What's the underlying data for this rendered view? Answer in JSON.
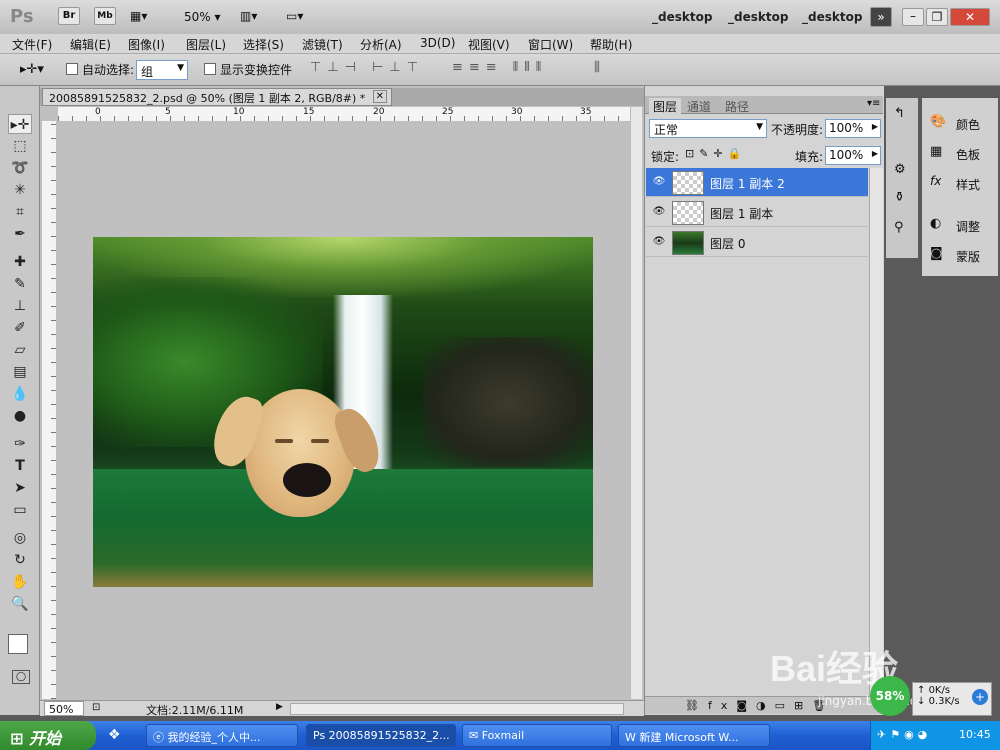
{
  "appbar": {
    "logo": "Ps",
    "br": "Br",
    "mb": "Mb",
    "zoom": "50%",
    "workspaces": [
      "_desktop",
      "_desktop",
      "_desktop"
    ]
  },
  "menu": [
    "文件(F)",
    "编辑(E)",
    "图像(I)",
    "图层(L)",
    "选择(S)",
    "滤镜(T)",
    "分析(A)",
    "3D(D)",
    "视图(V)",
    "窗口(W)",
    "帮助(H)"
  ],
  "options": {
    "auto_select_label": "自动选择:",
    "auto_select_value": "组",
    "show_transform_label": "显示变换控件"
  },
  "document": {
    "tab_title": "20085891525832_2.psd @ 50% (图层 1 副本 2, RGB/8#) *",
    "ruler_labels": [
      "0",
      "5",
      "10",
      "15",
      "20",
      "25",
      "30",
      "35"
    ],
    "zoom": "50%",
    "doc_size": "文档:2.11M/6.11M"
  },
  "panels": {
    "tabs": [
      "图层",
      "通道",
      "路径"
    ],
    "blend_mode": "正常",
    "opacity_label": "不透明度:",
    "opacity_value": "100%",
    "lock_label": "锁定:",
    "fill_label": "填充:",
    "fill_value": "100%",
    "layers": [
      {
        "name": "图层 1 副本 2",
        "selected": true
      },
      {
        "name": "图层 1 副本",
        "selected": false
      },
      {
        "name": "图层 0",
        "selected": false
      }
    ]
  },
  "dock": {
    "items": [
      "颜色",
      "色板",
      "样式",
      "调整",
      "蒙版"
    ]
  },
  "taskbar": {
    "start": "开始",
    "tasks": [
      "我的经验_个人中...",
      "20085891525832_2...",
      "Foxmail",
      "新建 Microsoft W..."
    ],
    "net_up": "0K/s",
    "net_down": "0.3K/s",
    "net_pct": "58%",
    "time": "10:45"
  },
  "watermark": {
    "text": "Bai经验",
    "url": "jingyan.baidu.com"
  },
  "colors": {
    "selected_layer": "#3a77d8",
    "taskbar": "#2463d6",
    "start_button": "#3a9b35"
  }
}
